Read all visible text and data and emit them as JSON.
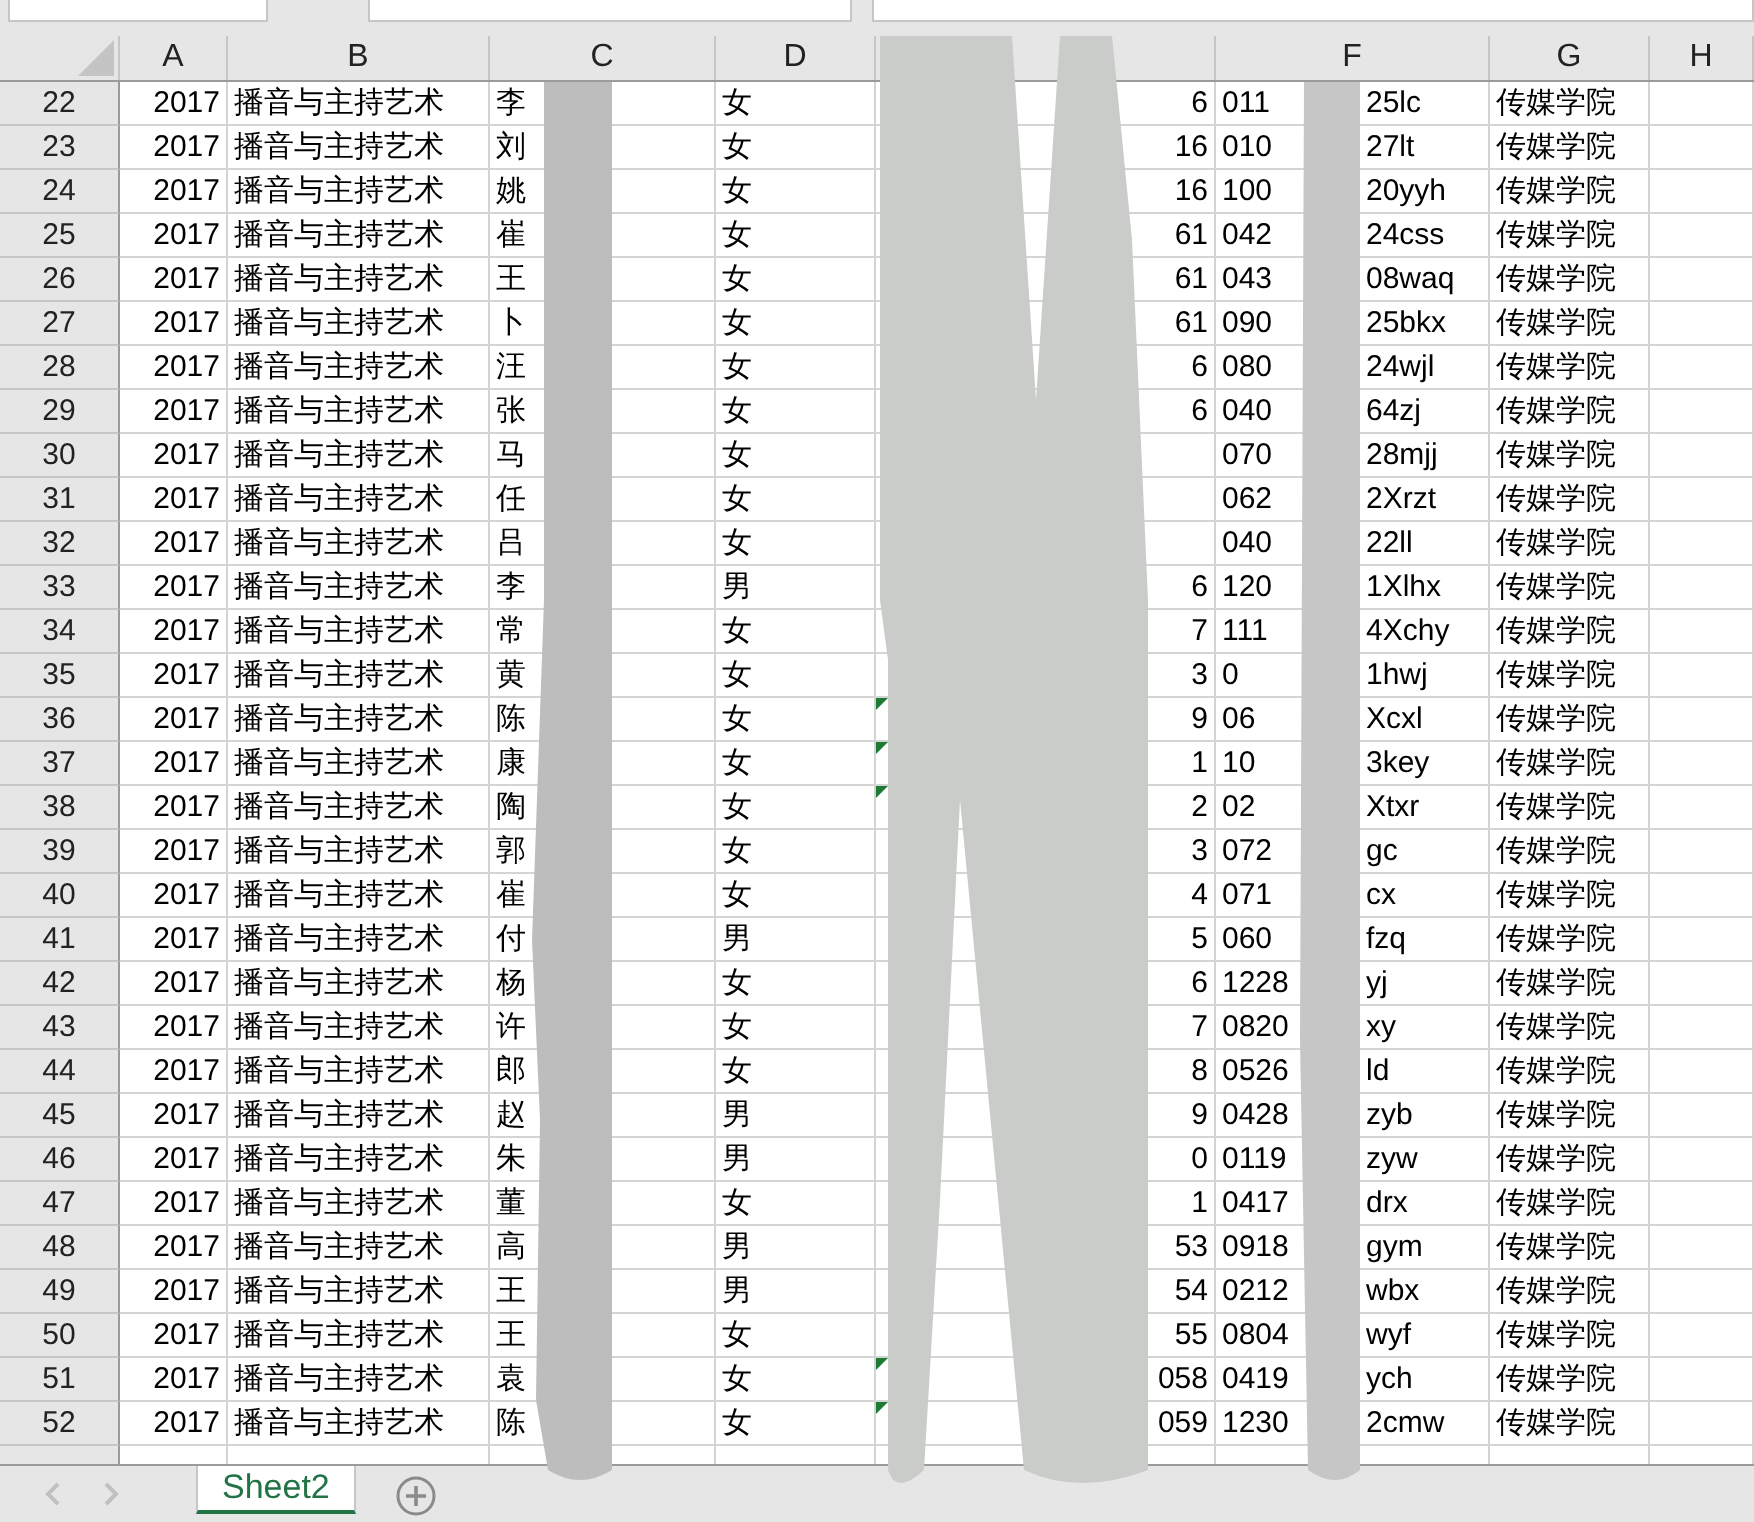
{
  "columns": [
    {
      "label": "A"
    },
    {
      "label": "B"
    },
    {
      "label": "C"
    },
    {
      "label": "D"
    },
    {
      "label": "F"
    },
    {
      "label": "G"
    },
    {
      "label": "H"
    }
  ],
  "rows": [
    {
      "num": "22",
      "a": "2017",
      "b": "播音与主持艺术",
      "c": "李",
      "d": "女",
      "e": "6",
      "f_start": "011",
      "f_end": "25lc",
      "g": "传媒学院",
      "flag": false
    },
    {
      "num": "23",
      "a": "2017",
      "b": "播音与主持艺术",
      "c": "刘",
      "d": "女",
      "e": "16",
      "f_start": "010",
      "f_end": "27lt",
      "g": "传媒学院",
      "flag": false
    },
    {
      "num": "24",
      "a": "2017",
      "b": "播音与主持艺术",
      "c": "姚",
      "d": "女",
      "e": "16",
      "f_start": "100",
      "f_end": "20yyh",
      "g": "传媒学院",
      "flag": false
    },
    {
      "num": "25",
      "a": "2017",
      "b": "播音与主持艺术",
      "c": "崔",
      "d": "女",
      "e": "61",
      "f_start": "042",
      "f_end": "24css",
      "g": "传媒学院",
      "flag": false
    },
    {
      "num": "26",
      "a": "2017",
      "b": "播音与主持艺术",
      "c": "王",
      "d": "女",
      "e": "61",
      "f_start": "043",
      "f_end": "08waq",
      "g": "传媒学院",
      "flag": false
    },
    {
      "num": "27",
      "a": "2017",
      "b": "播音与主持艺术",
      "c": "卜",
      "d": "女",
      "e": "61",
      "f_start": "090",
      "f_end": "25bkx",
      "g": "传媒学院",
      "flag": false
    },
    {
      "num": "28",
      "a": "2017",
      "b": "播音与主持艺术",
      "c": "汪",
      "d": "女",
      "e": "6",
      "f_start": "080",
      "f_end": "24wjl",
      "g": "传媒学院",
      "flag": false
    },
    {
      "num": "29",
      "a": "2017",
      "b": "播音与主持艺术",
      "c": "张",
      "d": "女",
      "e": "6",
      "f_start": "040",
      "f_end": "64zj",
      "g": "传媒学院",
      "flag": false
    },
    {
      "num": "30",
      "a": "2017",
      "b": "播音与主持艺术",
      "c": "马",
      "d": "女",
      "f_start": "070",
      "f_end": "28mjj",
      "g": "传媒学院",
      "flag": false
    },
    {
      "num": "31",
      "a": "2017",
      "b": "播音与主持艺术",
      "c": "任",
      "d": "女",
      "f_start": "062",
      "f_end": "2Xrzt",
      "g": "传媒学院",
      "flag": false
    },
    {
      "num": "32",
      "a": "2017",
      "b": "播音与主持艺术",
      "c": "吕",
      "d": "女",
      "f_start": "040",
      "f_end": "22ll",
      "g": "传媒学院",
      "flag": false
    },
    {
      "num": "33",
      "a": "2017",
      "b": "播音与主持艺术",
      "c": "李",
      "d": "男",
      "e": "6",
      "f_start": "120",
      "f_end": "1Xlhx",
      "g": "传媒学院",
      "flag": false
    },
    {
      "num": "34",
      "a": "2017",
      "b": "播音与主持艺术",
      "c": "常",
      "d": "女",
      "e": "7",
      "f_start": "111",
      "f_end": "4Xchy",
      "g": "传媒学院",
      "flag": false
    },
    {
      "num": "35",
      "a": "2017",
      "b": "播音与主持艺术",
      "c": "黄",
      "d": "女",
      "e": "3",
      "f_start": "0",
      "f_end": "1hwj",
      "g": "传媒学院",
      "flag": false
    },
    {
      "num": "36",
      "a": "2017",
      "b": "播音与主持艺术",
      "c": "陈",
      "d": "女",
      "e": "9",
      "f_start": "06",
      "f_end": "Xcxl",
      "g": "传媒学院",
      "flag": true
    },
    {
      "num": "37",
      "a": "2017",
      "b": "播音与主持艺术",
      "c": "康",
      "d": "女",
      "e": "1",
      "f_start": "10",
      "f_end": "3key",
      "g": "传媒学院",
      "flag": true
    },
    {
      "num": "38",
      "a": "2017",
      "b": "播音与主持艺术",
      "c": "陶",
      "d": "女",
      "e": "2",
      "f_start": "02",
      "f_end": "Xtxr",
      "g": "传媒学院",
      "flag": true
    },
    {
      "num": "39",
      "a": "2017",
      "b": "播音与主持艺术",
      "c": "郭",
      "d": "女",
      "e": "3",
      "f_start": "072",
      "f_end": "gc",
      "g": "传媒学院",
      "flag": false
    },
    {
      "num": "40",
      "a": "2017",
      "b": "播音与主持艺术",
      "c": "崔",
      "d": "女",
      "e": "4",
      "f_start": "071",
      "f_end": "cx",
      "g": "传媒学院",
      "flag": false
    },
    {
      "num": "41",
      "a": "2017",
      "b": "播音与主持艺术",
      "c": "付",
      "d": "男",
      "e": "5",
      "f_start": "060",
      "f_end": "fzq",
      "g": "传媒学院",
      "flag": false
    },
    {
      "num": "42",
      "a": "2017",
      "b": "播音与主持艺术",
      "c": "杨",
      "d": "女",
      "e": "6",
      "f_start": "1228",
      "f_end": "yj",
      "g": "传媒学院",
      "flag": false
    },
    {
      "num": "43",
      "a": "2017",
      "b": "播音与主持艺术",
      "c": "许",
      "d": "女",
      "e": "7",
      "f_start": "0820",
      "f_end": "xy",
      "g": "传媒学院",
      "flag": false
    },
    {
      "num": "44",
      "a": "2017",
      "b": "播音与主持艺术",
      "c": "郎",
      "d": "女",
      "e": "8",
      "f_start": "0526",
      "f_end": "ld",
      "g": "传媒学院",
      "flag": false
    },
    {
      "num": "45",
      "a": "2017",
      "b": "播音与主持艺术",
      "c": "赵",
      "d": "男",
      "e": "9",
      "f_start": "0428",
      "f_end": "zyb",
      "g": "传媒学院",
      "flag": false
    },
    {
      "num": "46",
      "a": "2017",
      "b": "播音与主持艺术",
      "c": "朱",
      "d": "男",
      "e": "0",
      "f_start": "0119",
      "f_end": "zyw",
      "g": "传媒学院",
      "flag": false
    },
    {
      "num": "47",
      "a": "2017",
      "b": "播音与主持艺术",
      "c": "董",
      "d": "女",
      "e": "1",
      "f_start": "0417",
      "f_end": "drx",
      "g": "传媒学院",
      "flag": false
    },
    {
      "num": "48",
      "a": "2017",
      "b": "播音与主持艺术",
      "c": "高",
      "d": "男",
      "e": "53",
      "f_start": "0918",
      "f_end": "gym",
      "g": "传媒学院",
      "flag": false
    },
    {
      "num": "49",
      "a": "2017",
      "b": "播音与主持艺术",
      "c": "王",
      "d": "男",
      "e": "54",
      "f_start": "0212",
      "f_end": "wbx",
      "g": "传媒学院",
      "flag": false
    },
    {
      "num": "50",
      "a": "2017",
      "b": "播音与主持艺术",
      "c": "王",
      "d": "女",
      "e": "55",
      "f_start": "0804",
      "f_end": "wyf",
      "g": "传媒学院",
      "flag": false
    },
    {
      "num": "51",
      "a": "2017",
      "b": "播音与主持艺术",
      "c": "袁",
      "d": "女",
      "e": "058",
      "f_start": "0419",
      "f_end": "ych",
      "g": "传媒学院",
      "flag": true
    },
    {
      "num": "52",
      "a": "2017",
      "b": "播音与主持艺术",
      "c": "陈",
      "d": "女",
      "e": "059",
      "f_start": "1230",
      "f_end": "2cmw",
      "g": "传媒学院",
      "flag": true
    }
  ],
  "sheet_tabs": [
    {
      "label": "Sheet2",
      "selected": true
    }
  ]
}
